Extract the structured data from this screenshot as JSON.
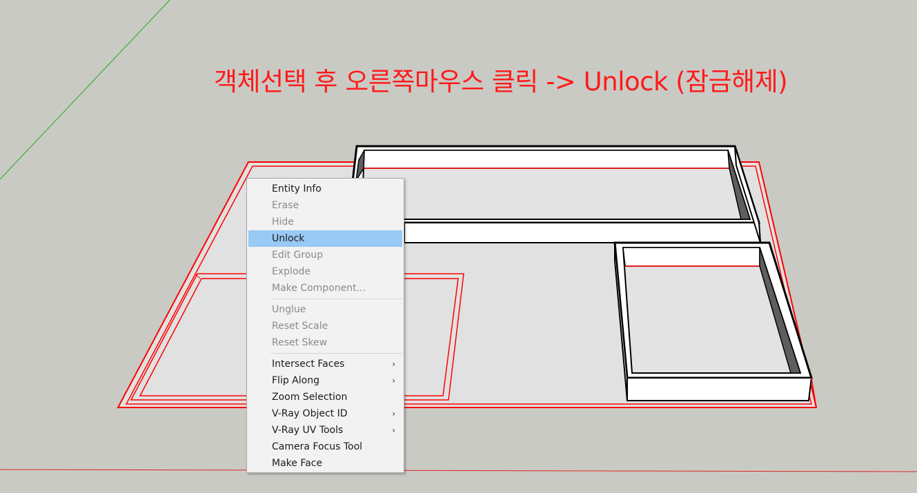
{
  "annotation": {
    "text": "객체선택 후 오른쪽마우스 클릭 -> Unlock (잠금해제)",
    "color": "#ff1a1a"
  },
  "viewport": {
    "background": "#cacac4",
    "selection_color": "#ff0000",
    "axis_green": "#22aa22",
    "axis_red": "#dd2222"
  },
  "context_menu": {
    "groups": [
      [
        {
          "label": "Entity Info",
          "enabled": true
        },
        {
          "label": "Erase",
          "enabled": false
        },
        {
          "label": "Hide",
          "enabled": false
        },
        {
          "label": "Unlock",
          "enabled": true,
          "highlighted": true
        },
        {
          "label": "Edit Group",
          "enabled": false
        },
        {
          "label": "Explode",
          "enabled": false
        },
        {
          "label": "Make Component...",
          "enabled": false
        }
      ],
      [
        {
          "label": "Unglue",
          "enabled": false
        },
        {
          "label": "Reset Scale",
          "enabled": false
        },
        {
          "label": "Reset Skew",
          "enabled": false
        }
      ],
      [
        {
          "label": "Intersect Faces",
          "enabled": true,
          "submenu": true
        },
        {
          "label": "Flip Along",
          "enabled": true,
          "submenu": true
        },
        {
          "label": "Zoom Selection",
          "enabled": true
        },
        {
          "label": "V-Ray Object ID",
          "enabled": true,
          "submenu": true
        },
        {
          "label": "V-Ray UV Tools",
          "enabled": true,
          "submenu": true
        },
        {
          "label": "Camera Focus Tool",
          "enabled": true
        },
        {
          "label": "Make Face",
          "enabled": true
        }
      ]
    ],
    "submenu_glyph": "›",
    "highlight_color": "#99c9f5"
  }
}
